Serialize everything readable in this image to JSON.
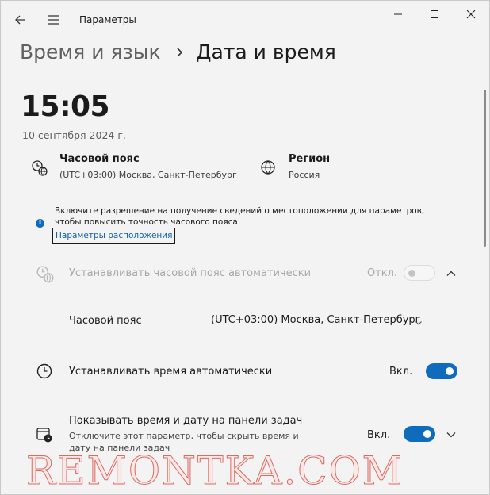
{
  "window": {
    "title": "Параметры"
  },
  "breadcrumb": {
    "parent": "Время и язык",
    "current": "Дата и время"
  },
  "clock": {
    "time": "15:05",
    "date": "10 сентября 2024 г."
  },
  "timezone_info": {
    "title": "Часовой пояс",
    "value": "(UTC+03:00) Москва, Санкт-Петербург"
  },
  "region_info": {
    "title": "Регион",
    "value": "Россия"
  },
  "notice": {
    "text": "Включите разрешение на получение сведений о местоположении для параметров, чтобы повысить точность часового пояса.",
    "link_label": "Параметры расположения"
  },
  "auto_timezone": {
    "label": "Устанавливать часовой пояс автоматически",
    "state_text": "Откл.",
    "state": false
  },
  "timezone_select": {
    "label": "Часовой пояс",
    "selected": "(UTC+03:00) Москва, Санкт-Петербург"
  },
  "auto_time": {
    "label": "Устанавливать время автоматически",
    "state_text": "Вкл.",
    "state": true
  },
  "taskbar_time": {
    "label": "Показывать время и дату на панели задач",
    "description": "Отключите этот параметр, чтобы скрыть время и дату на панели задач",
    "state_text": "Вкл.",
    "state": true
  },
  "watermark": {
    "text": "REMONTKA.COM"
  },
  "icons": {
    "back": "back-arrow-icon",
    "menu": "hamburger-menu-icon",
    "minimize": "minimize-icon",
    "maximize": "maximize-icon",
    "close": "close-icon",
    "timezone": "clock-globe-icon",
    "region": "globe-icon",
    "info": "info-icon",
    "auto_time": "clock-icon",
    "taskbar": "calendar-clock-icon"
  },
  "colors": {
    "accent": "#0f6cbd",
    "background": "#f3f3f3",
    "link": "#0f5fa8",
    "watermark_stroke": "#d96b62"
  }
}
